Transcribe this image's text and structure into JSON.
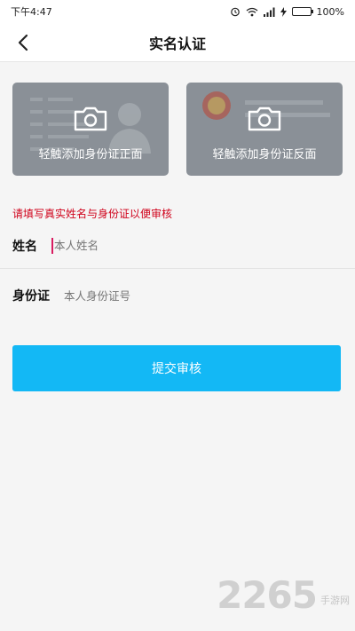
{
  "status_bar": {
    "time": "下午4:47",
    "battery_percent": "100%",
    "battery_level": 1.0,
    "icons": [
      "alarm-icon",
      "wifi-icon",
      "signal-icon",
      "charging-icon",
      "battery-icon"
    ]
  },
  "header": {
    "title": "实名认证",
    "back_icon": "chevron-left-icon"
  },
  "id_cards": {
    "front_label": "轻触添加身份证正面",
    "back_label": "轻触添加身份证反面",
    "camera_icon": "camera-icon"
  },
  "form": {
    "notice": "请填写真实姓名与身份证以便审核",
    "name_label": "姓名",
    "name_placeholder": "本人姓名",
    "id_label": "身份证",
    "id_placeholder": "本人身份证号"
  },
  "submit_label": "提交审核",
  "watermark": {
    "number": "2265",
    "text": "手游网"
  },
  "colors": {
    "accent": "#13b8f5",
    "notice": "#d0021b",
    "card_bg": "#8a9097"
  }
}
